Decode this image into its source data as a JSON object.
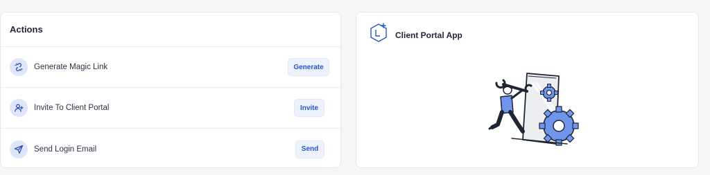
{
  "actions_card": {
    "title": "Actions",
    "items": [
      {
        "label": "Generate Magic Link",
        "button": "Generate",
        "icon": "link-broken-icon"
      },
      {
        "label": "Invite To Client Portal",
        "button": "Invite",
        "icon": "user-plus-icon"
      },
      {
        "label": "Send Login Email",
        "button": "Send",
        "icon": "paper-plane-icon"
      }
    ]
  },
  "portal_card": {
    "title": "Client Portal App",
    "icon": "hexagon-plus-icon",
    "illustration": "person-with-wrench-and-gears"
  },
  "colors": {
    "accent": "#2457c7",
    "icon_bg": "#dfe6fb",
    "button_bg": "#eef2fc",
    "illustration_blue": "#6f96ec"
  }
}
